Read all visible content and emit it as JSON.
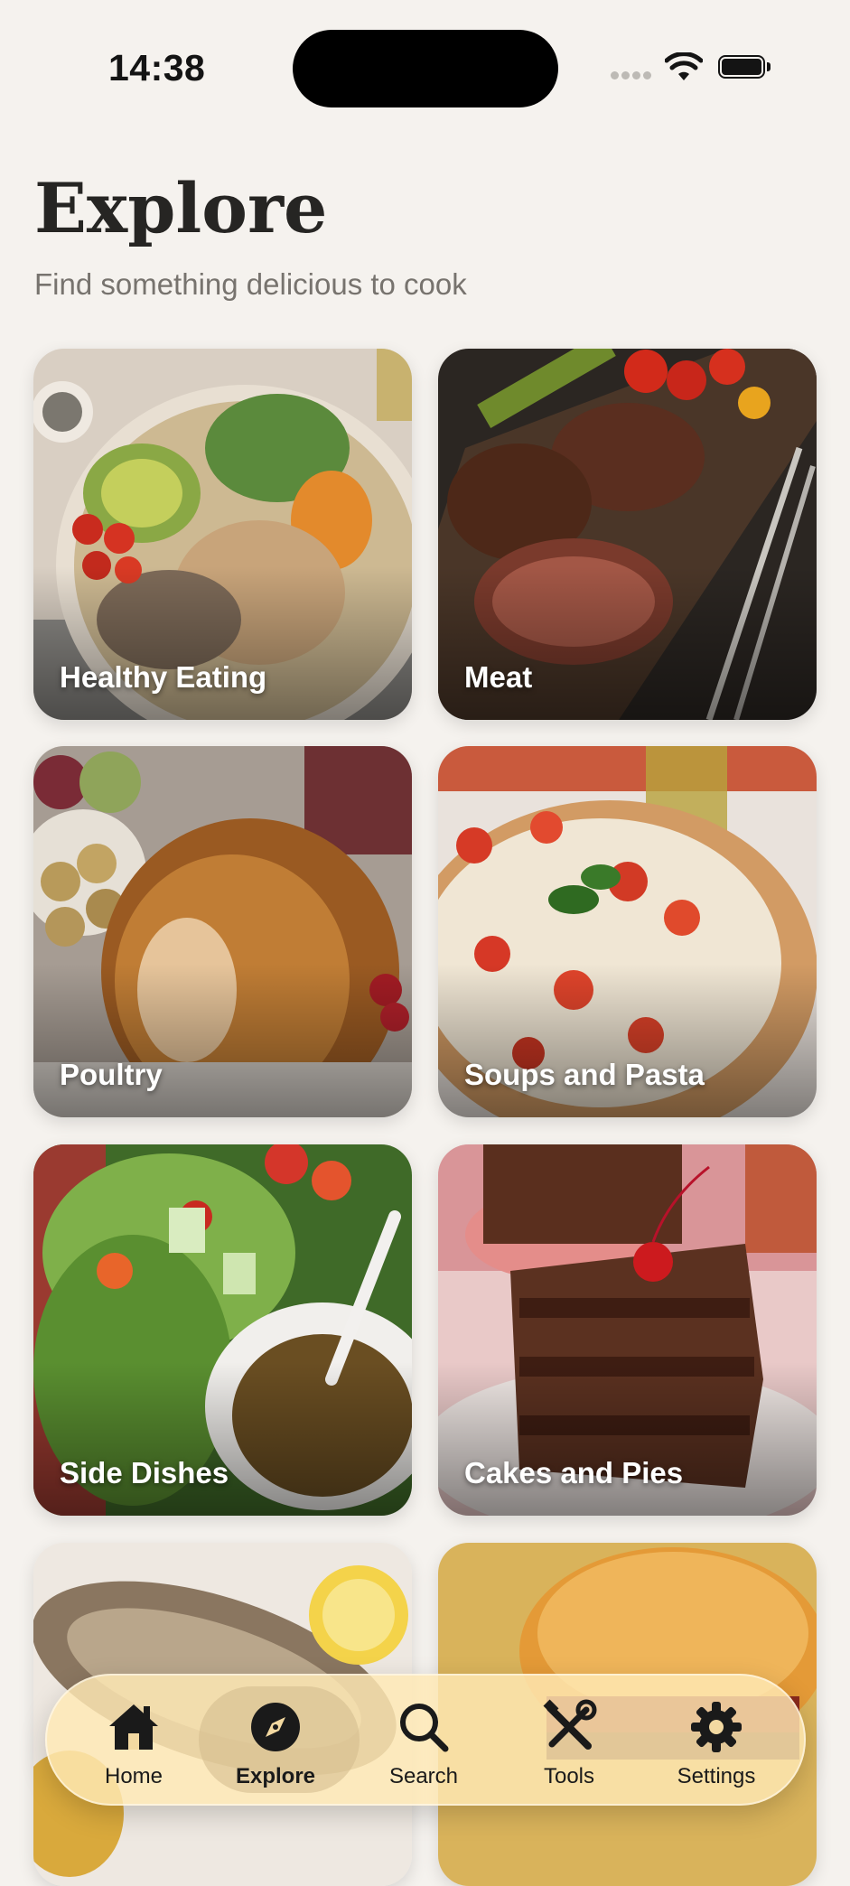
{
  "status": {
    "time": "14:38"
  },
  "header": {
    "title": "Explore",
    "subtitle": "Find something delicious to cook"
  },
  "categories": [
    {
      "label": "Healthy Eating"
    },
    {
      "label": "Meat"
    },
    {
      "label": "Poultry"
    },
    {
      "label": "Soups and Pasta"
    },
    {
      "label": "Side Dishes"
    },
    {
      "label": "Cakes and Pies"
    }
  ],
  "tabs": [
    {
      "label": "Home",
      "icon": "home-icon"
    },
    {
      "label": "Explore",
      "icon": "compass-icon",
      "active": true
    },
    {
      "label": "Search",
      "icon": "search-icon"
    },
    {
      "label": "Tools",
      "icon": "tools-icon"
    },
    {
      "label": "Settings",
      "icon": "gear-icon"
    }
  ]
}
